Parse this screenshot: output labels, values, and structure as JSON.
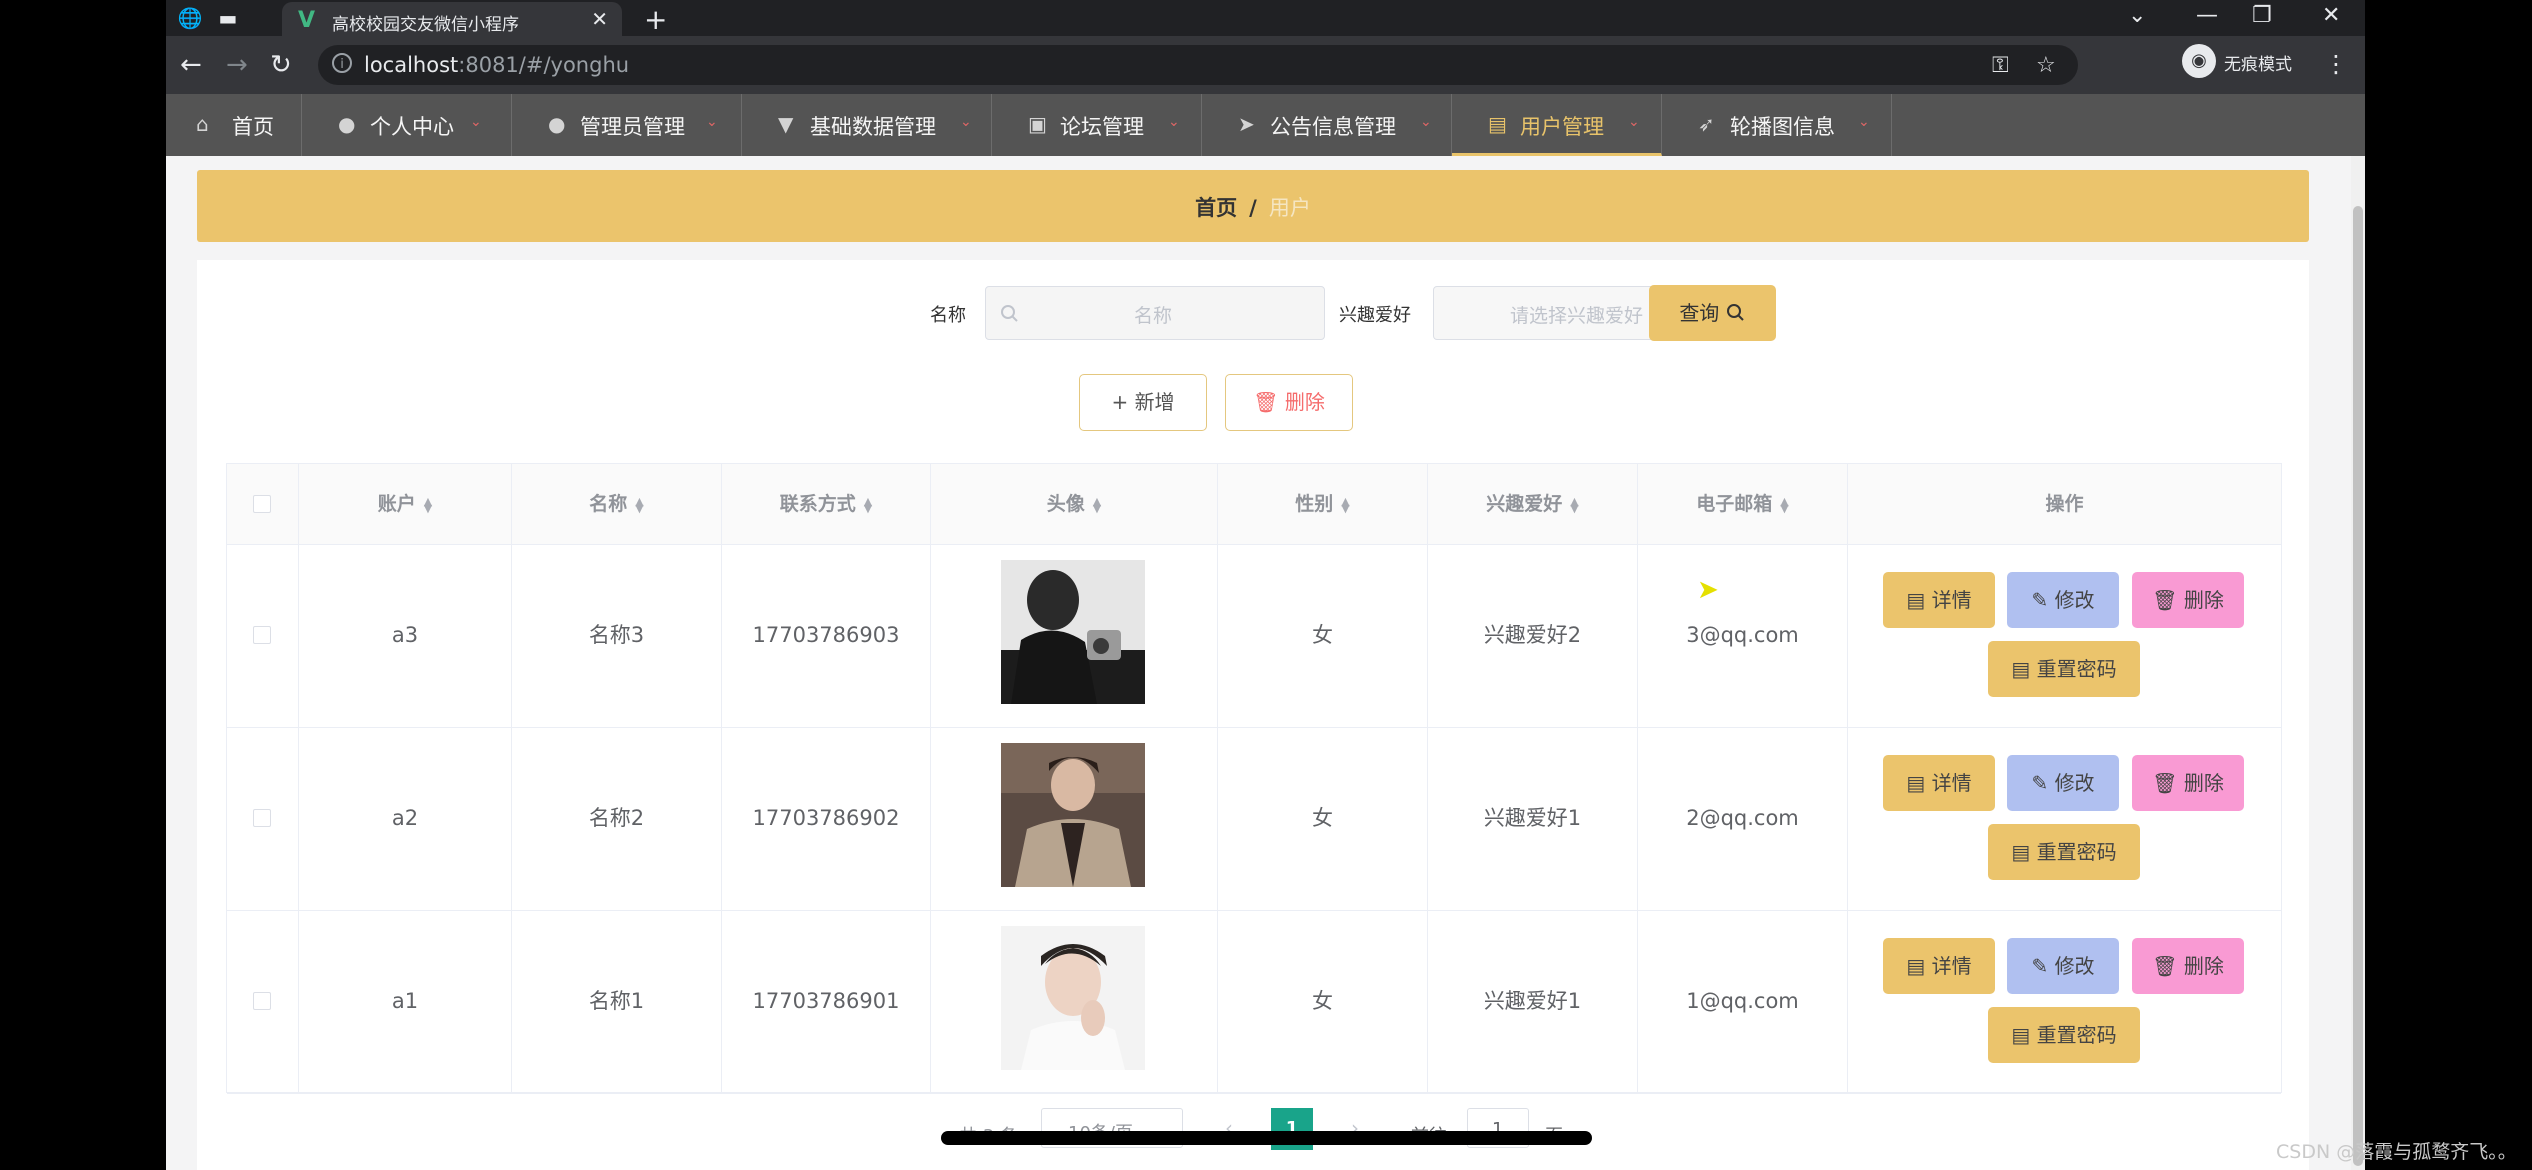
{
  "browser": {
    "tab_title": "高校校园交友微信小程序",
    "url_host": "localhost",
    "url_rest": ":8081/#/yonghu",
    "incognito_label": "无痕模式"
  },
  "nav": {
    "items": [
      {
        "label": "首页",
        "icon": "home-icon"
      },
      {
        "label": "个人中心",
        "icon": "user-icon"
      },
      {
        "label": "管理员管理",
        "icon": "user-icon"
      },
      {
        "label": "基础数据管理",
        "icon": "stamp-icon"
      },
      {
        "label": "论坛管理",
        "icon": "briefcase-icon"
      },
      {
        "label": "公告信息管理",
        "icon": "send-icon"
      },
      {
        "label": "用户管理",
        "icon": "clipboard-icon"
      },
      {
        "label": "轮播图信息",
        "icon": "navigation-icon"
      }
    ],
    "active": "用户管理"
  },
  "breadcrumb": {
    "home": "首页",
    "sep": "/",
    "current": "用户"
  },
  "search": {
    "name_label": "名称",
    "name_placeholder": "名称",
    "hobby_label": "兴趣爱好",
    "hobby_placeholder": "请选择兴趣爱好",
    "search_button": "查询"
  },
  "actions": {
    "add": "新增",
    "delete": "删除"
  },
  "table": {
    "headers": [
      "账户",
      "名称",
      "联系方式",
      "头像",
      "性别",
      "兴趣爱好",
      "电子邮箱",
      "操作"
    ],
    "rows": [
      {
        "account": "a3",
        "name": "名称3",
        "phone": "17703786903",
        "gender": "女",
        "hobby": "兴趣爱好2",
        "email": "3@qq.com"
      },
      {
        "account": "a2",
        "name": "名称2",
        "phone": "17703786902",
        "gender": "女",
        "hobby": "兴趣爱好1",
        "email": "2@qq.com"
      },
      {
        "account": "a1",
        "name": "名称1",
        "phone": "17703786901",
        "gender": "女",
        "hobby": "兴趣爱好1",
        "email": "1@qq.com"
      }
    ],
    "row_buttons": {
      "detail": "详情",
      "edit": "修改",
      "delete": "删除",
      "reset": "重置密码"
    }
  },
  "pagination": {
    "total": "共 3 条",
    "page_size": "10条/页",
    "current_page": "1",
    "goto_label": "前往",
    "goto_value": "1",
    "page_unit": "页"
  },
  "watermark": "CSDN @落霞与孤鹜齐飞。。",
  "colors": {
    "accent": "#ebc46c",
    "nav_bg": "#545454",
    "pager_active": "#19a48a",
    "delete": "#f99ad3",
    "edit": "#b0c0f0"
  }
}
